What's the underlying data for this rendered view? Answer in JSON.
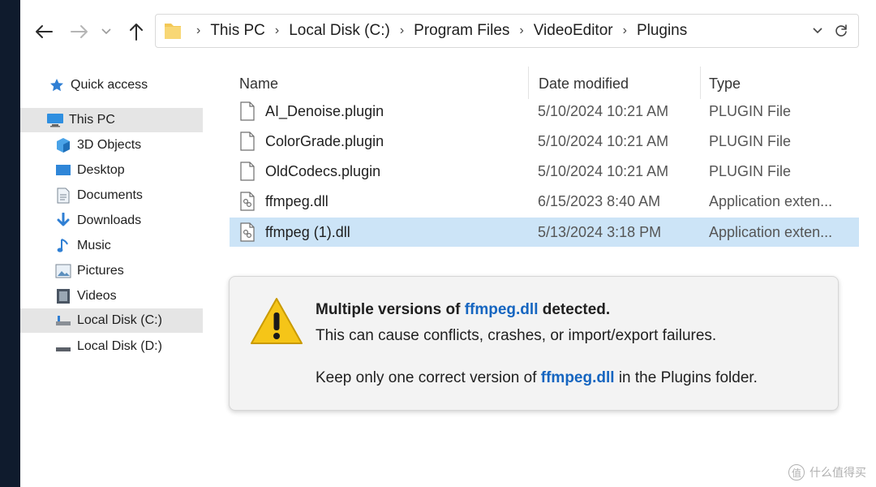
{
  "address": {
    "crumbs": [
      "This PC",
      "Local Disk (C:)",
      "Program Files",
      "VideoEditor",
      "Plugins"
    ]
  },
  "sidebar": {
    "items": [
      {
        "label": "Quick access",
        "icon": "star-icon"
      },
      {
        "label": "This PC",
        "icon": "computer-icon",
        "selected": true
      },
      {
        "label": "3D Objects",
        "icon": "cube-icon"
      },
      {
        "label": "Desktop",
        "icon": "desktop-icon"
      },
      {
        "label": "Documents",
        "icon": "document-icon"
      },
      {
        "label": "Downloads",
        "icon": "download-icon"
      },
      {
        "label": "Music",
        "icon": "music-icon"
      },
      {
        "label": "Pictures",
        "icon": "picture-icon"
      },
      {
        "label": "Videos",
        "icon": "video-icon"
      },
      {
        "label": "Local Disk (C:)",
        "icon": "drive-icon",
        "selected": true
      },
      {
        "label": "Local Disk (D:)",
        "icon": "drive-icon"
      }
    ]
  },
  "columns": {
    "name": "Name",
    "date": "Date modified",
    "type": "Type"
  },
  "files": [
    {
      "name": "AI_Denoise.plugin",
      "date": "5/10/2024 10:21 AM",
      "type": "PLUGIN File",
      "icon": "file-icon"
    },
    {
      "name": "ColorGrade.plugin",
      "date": "5/10/2024 10:21 AM",
      "type": "PLUGIN File",
      "icon": "file-icon"
    },
    {
      "name": "OldCodecs.plugin",
      "date": "5/10/2024 10:21 AM",
      "type": "PLUGIN File",
      "icon": "file-icon"
    },
    {
      "name": "ffmpeg.dll",
      "date": "6/15/2023 8:40 AM",
      "type": "Application exten...",
      "icon": "dll-file-icon"
    },
    {
      "name": "ffmpeg (1).dll",
      "date": "5/13/2024 3:18 PM",
      "type": "Application exten...",
      "icon": "dll-file-icon",
      "selected": true
    }
  ],
  "warning": {
    "title_pre": "Multiple versions of ",
    "title_file": "ffmpeg.dll",
    "title_post": " detected.",
    "line2": "This can cause conflicts, crashes, or import/export failures.",
    "line3_pre": "Keep only one correct version of ",
    "line3_file": "ffmpeg.dll",
    "line3_post": " in the Plugins folder."
  },
  "watermark": {
    "text": "什么值得买",
    "icon_glyph": "值"
  },
  "colors": {
    "selection": "#cce4f7",
    "link": "#1565c0",
    "warning": "#f5c518"
  }
}
